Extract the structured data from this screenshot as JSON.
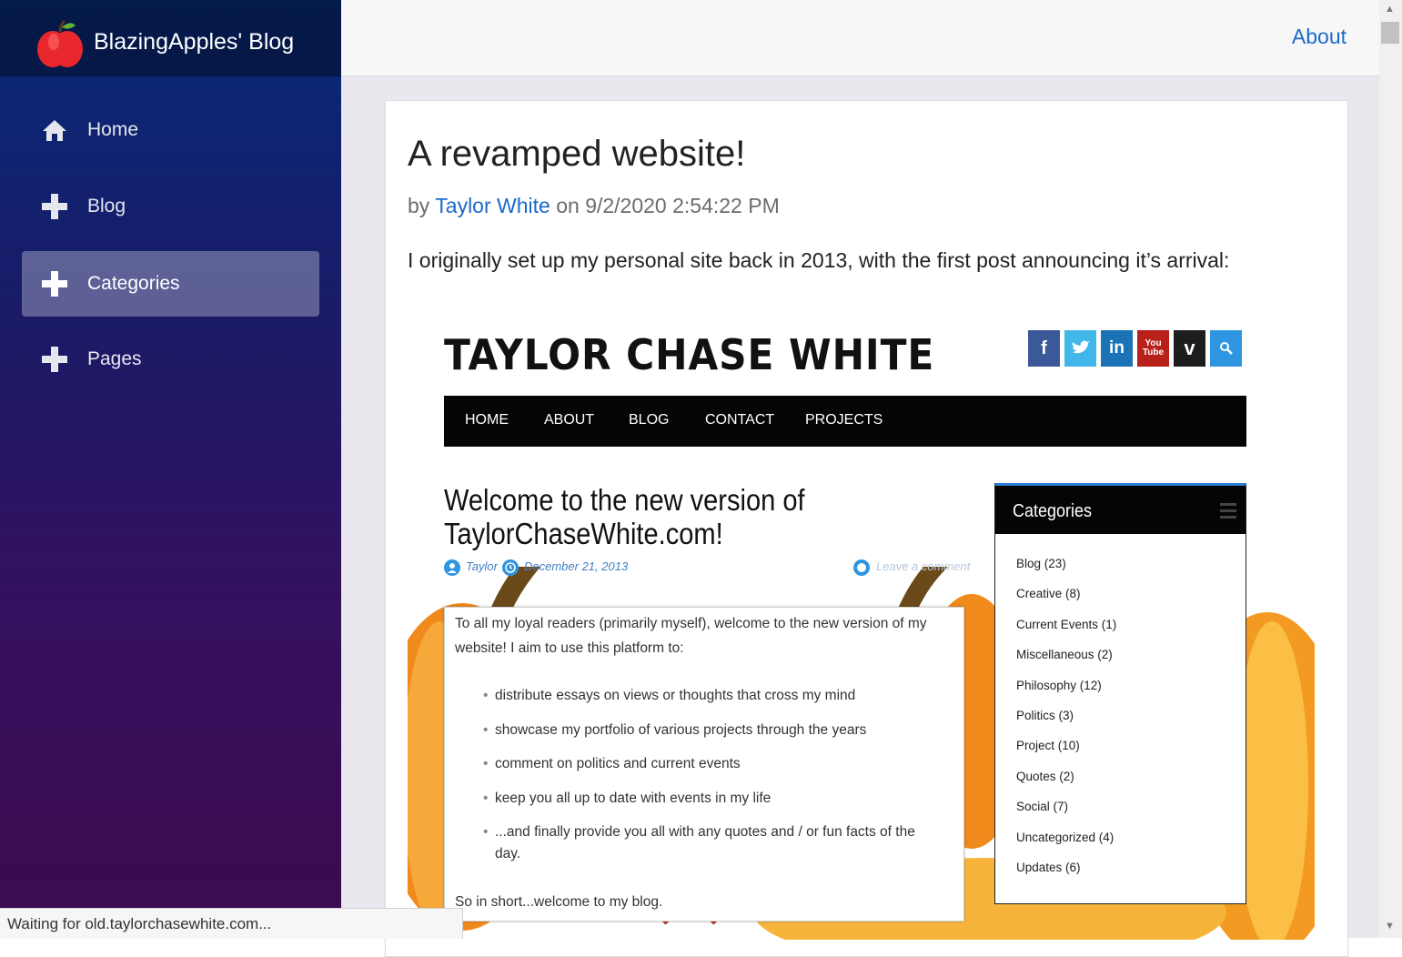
{
  "brand": {
    "title": "BlazingApples' Blog",
    "logo_icon": "apple-icon"
  },
  "sidebar": {
    "items": [
      {
        "label": "Home",
        "icon": "home-icon",
        "active": false
      },
      {
        "label": "Blog",
        "icon": "plus-icon",
        "active": false
      },
      {
        "label": "Categories",
        "icon": "plus-icon",
        "active": true
      },
      {
        "label": "Pages",
        "icon": "plus-icon",
        "active": false
      }
    ]
  },
  "topbar": {
    "about_label": "About"
  },
  "post": {
    "title": "A revamped website!",
    "meta_by": "by",
    "author": "Taylor White",
    "meta_on": "on 9/2/2020 2:54:22 PM",
    "intro": "I originally set up my personal site back in 2013, with the first post announcing it’s arrival:"
  },
  "screenshot": {
    "site_title": "TAYLOR CHASE WHITE",
    "social_icons": [
      "facebook-icon",
      "twitter-icon",
      "linkedin-icon",
      "youtube-icon",
      "vimeo-icon",
      "search-icon"
    ],
    "nav": [
      "HOME",
      "ABOUT",
      "BLOG",
      "CONTACT",
      "PROJECTS"
    ],
    "heading_line1": "Welcome to the new version of",
    "heading_line2": "TaylorChaseWhite.com!",
    "meta_author": "Taylor",
    "meta_date": "December 21, 2013",
    "meta_comment": "Leave a comment",
    "paragraph": "To all my loyal readers (primarily myself), welcome to the new version of my website! I aim to use this platform to:",
    "bullets": [
      "distribute essays on views or thoughts that cross my mind",
      "showcase my portfolio of various projects through the years",
      "comment on politics and current events",
      "keep you all up to date with events in my life",
      "...and finally provide you all with any quotes and / or fun facts of the day."
    ],
    "closing": "So in short...welcome to my blog.",
    "categories_title": "Categories",
    "categories": [
      "Blog (23)",
      "Creative (8)",
      "Current Events (1)",
      "Miscellaneous (2)",
      "Philosophy (12)",
      "Politics (3)",
      "Project (10)",
      "Quotes (2)",
      "Social (7)",
      "Uncategorized (4)",
      "Updates (6)"
    ]
  },
  "status_bar": {
    "text": "Waiting for old.taylorchasewhite.com..."
  },
  "colors": {
    "link": "#1b6ac9",
    "sidebar_top": "#062a78",
    "sidebar_bottom": "#3d0a4f"
  }
}
